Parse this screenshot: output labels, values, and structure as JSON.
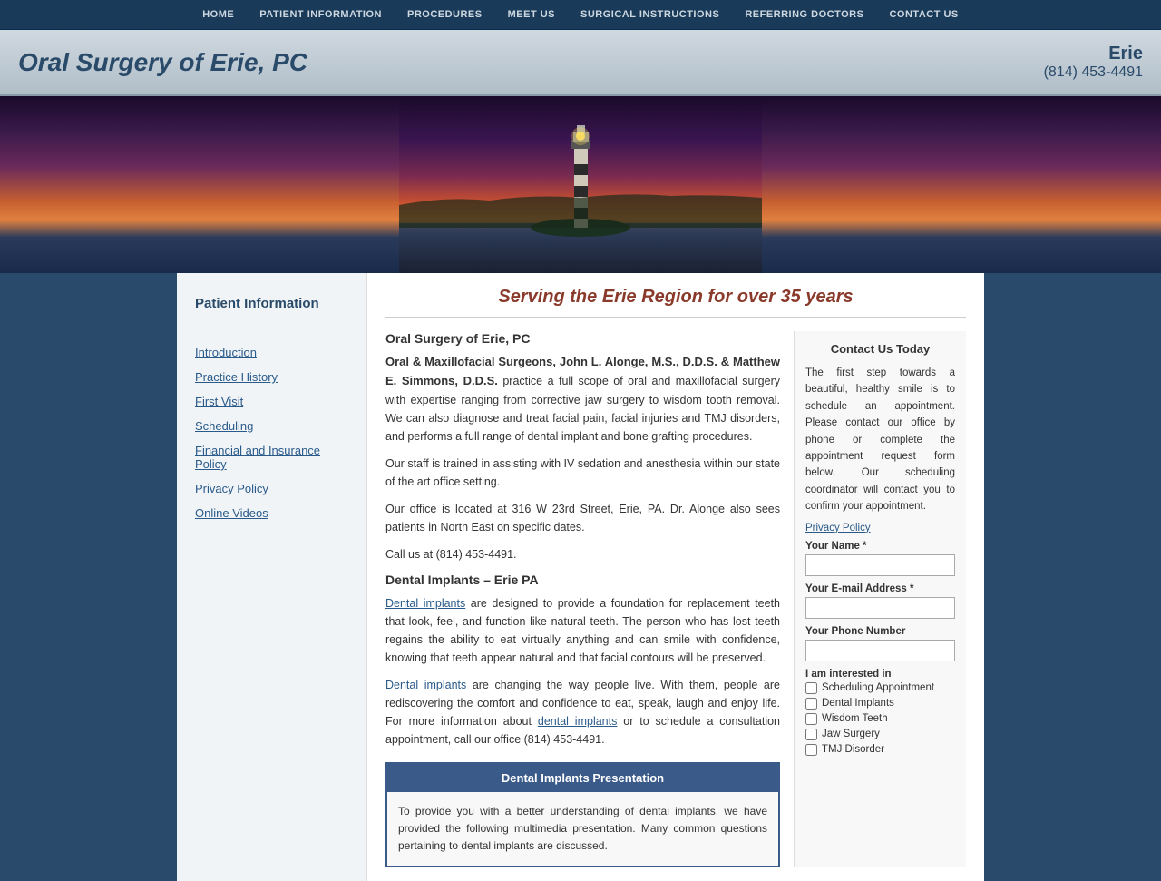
{
  "nav": {
    "items": [
      "HOME",
      "PATIENT INFORMATION",
      "PROCEDURES",
      "MEET US",
      "SURGICAL INSTRUCTIONS",
      "REFERRING DOCTORS",
      "CONTACT US"
    ]
  },
  "header": {
    "title": "Oral Surgery of Erie, PC",
    "location": "Erie",
    "phone": "(814) 453-4491"
  },
  "page_heading": "Serving the Erie Region for over 35 years",
  "sidebar": {
    "title": "Patient Information",
    "links": [
      "Introduction",
      "Practice History",
      "First Visit",
      "Scheduling",
      "Financial and Insurance Policy",
      "Privacy Policy",
      "Online Videos"
    ]
  },
  "content": {
    "clinic_name": "Oral Surgery of Erie, PC",
    "surgeons_label": "Oral & Maxillofacial Surgeons, John L. Alonge, M.S., D.D.S. & Matthew E. Simmons, D.D.S.",
    "para1": "practice a full scope of oral and maxillofacial surgery with expertise ranging from corrective jaw surgery to wisdom tooth removal. We can also diagnose and treat facial pain, facial injuries and TMJ disorders, and performs a full range of dental implant and bone grafting procedures.",
    "para2": "Our staff is trained in assisting with IV sedation and anesthesia within our state of the art office setting.",
    "para3": "Our office is located at 316 W 23rd Street, Erie, PA. Dr. Alonge also sees patients in North East on specific dates.",
    "para4": "Call us at (814) 453-4491.",
    "implants_heading": "Dental Implants – Erie PA",
    "implants_para1_link": "Dental implants",
    "implants_para1_rest": " are designed to provide a foundation for replacement teeth that look, feel, and function like natural teeth. The person who has lost teeth regains the ability to eat virtually anything and can smile with confidence, knowing that teeth appear natural and that facial contours will be preserved.",
    "implants_para2_link": "Dental implants",
    "implants_para2_rest": " are changing the way people live. With them, people are rediscovering the comfort and confidence to eat, speak, laugh and enjoy life. For more information about ",
    "implants_para2_link2": "dental implants",
    "implants_para2_end": " or to schedule a consultation appointment, call our office (814) 453-4491.",
    "implants_box_header": "Dental Implants Presentation",
    "implants_box_body": "To provide you with a better understanding of dental implants, we have provided the following multimedia presentation. Many common questions pertaining to dental implants are discussed."
  },
  "contact_form": {
    "heading": "Contact Us Today",
    "description": "The first step towards a beautiful, healthy smile is to schedule an appointment. Please contact our office by phone or complete the appointment request form below. Our scheduling coordinator will contact you to confirm your appointment.",
    "privacy_link": "Privacy Policy",
    "name_label": "Your Name *",
    "email_label": "Your E-mail Address *",
    "phone_label": "Your Phone Number",
    "interested_label": "I am interested in",
    "checkboxes": [
      "Scheduling Appointment",
      "Dental Implants",
      "Wisdom Teeth",
      "Jaw Surgery",
      "TMJ Disorder"
    ]
  }
}
